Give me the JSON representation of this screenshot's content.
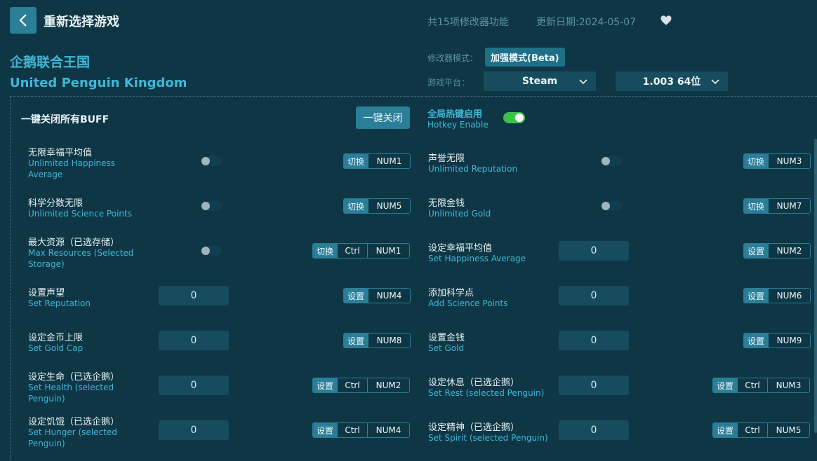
{
  "header": {
    "back_label": "重新选择游戏",
    "feature_count": "共15项修改器功能",
    "update_date": "更新日期:2024-05-07"
  },
  "game": {
    "name_cn": "企鹅联合王国",
    "name_en": "United Penguin Kingdom"
  },
  "settings": {
    "mode_label": "修改器模式：",
    "mode_value": "加强模式(Beta)",
    "platform_label": "游戏平台：",
    "platform_value": "Steam",
    "version_value": "1.003 64位"
  },
  "global": {
    "buff_label": "一键关闭所有BUFF",
    "onekey_btn": "一键关闭",
    "hotkey_cn": "全局热键启用",
    "hotkey_en": "Hotkey Enable",
    "hotkey_enabled": true
  },
  "cheats_left": [
    {
      "cn": "无限幸福平均值",
      "en": "Unlimited Happiness Average",
      "type": "toggle",
      "action": "切换",
      "keys": [
        "NUM1"
      ]
    },
    {
      "cn": "科学分数无限",
      "en": "Unlimited Science Points",
      "type": "toggle",
      "action": "切换",
      "keys": [
        "NUM5"
      ]
    },
    {
      "cn": "最大资源（已选存储）",
      "en": "Max Resources (Selected Storage)",
      "type": "toggle",
      "action": "切换",
      "keys": [
        "Ctrl",
        "NUM1"
      ]
    },
    {
      "cn": "设置声望",
      "en": "Set Reputation",
      "type": "input",
      "value": "0",
      "action": "设置",
      "keys": [
        "NUM4"
      ]
    },
    {
      "cn": "设定金币上限",
      "en": "Set Gold Cap",
      "type": "input",
      "value": "0",
      "action": "设置",
      "keys": [
        "NUM8"
      ]
    },
    {
      "cn": "设定生命（已选企鹅）",
      "en": "Set Health (selected Penguin)",
      "type": "input",
      "value": "0",
      "action": "设置",
      "keys": [
        "Ctrl",
        "NUM2"
      ]
    },
    {
      "cn": "设定饥饿（已选企鹅）",
      "en": "Set Hunger (selected Penguin)",
      "type": "input",
      "value": "0",
      "action": "设置",
      "keys": [
        "Ctrl",
        "NUM4"
      ]
    }
  ],
  "cheats_right": [
    {
      "cn": "声誉无限",
      "en": "Unlimited Reputation",
      "type": "toggle",
      "action": "切换",
      "keys": [
        "NUM3"
      ]
    },
    {
      "cn": "无限金钱",
      "en": "Unlimited Gold",
      "type": "toggle",
      "action": "切换",
      "keys": [
        "NUM7"
      ]
    },
    {
      "cn": "设定幸福平均值",
      "en": "Set Happiness Average",
      "type": "input",
      "value": "0",
      "action": "设置",
      "keys": [
        "NUM2"
      ]
    },
    {
      "cn": "添加科学点",
      "en": "Add Science Points",
      "type": "input",
      "value": "0",
      "action": "设置",
      "keys": [
        "NUM6"
      ]
    },
    {
      "cn": "设置金钱",
      "en": "Set Gold",
      "type": "input",
      "value": "0",
      "action": "设置",
      "keys": [
        "NUM9"
      ]
    },
    {
      "cn": "设定休息（已选企鹅）",
      "en": "Set Rest (selected Penguin)",
      "type": "input",
      "value": "0",
      "action": "设置",
      "keys": [
        "Ctrl",
        "NUM3"
      ]
    },
    {
      "cn": "设定精神（已选企鹅）",
      "en": "Set Spirit (selected Penguin)",
      "type": "input",
      "value": "0",
      "action": "设置",
      "keys": [
        "Ctrl",
        "NUM5"
      ]
    }
  ],
  "colors": {
    "background": "#0e3645",
    "accent": "#2a7e98",
    "title_cyan": "#3fb8d8",
    "toggle_on": "#3ec24c"
  }
}
